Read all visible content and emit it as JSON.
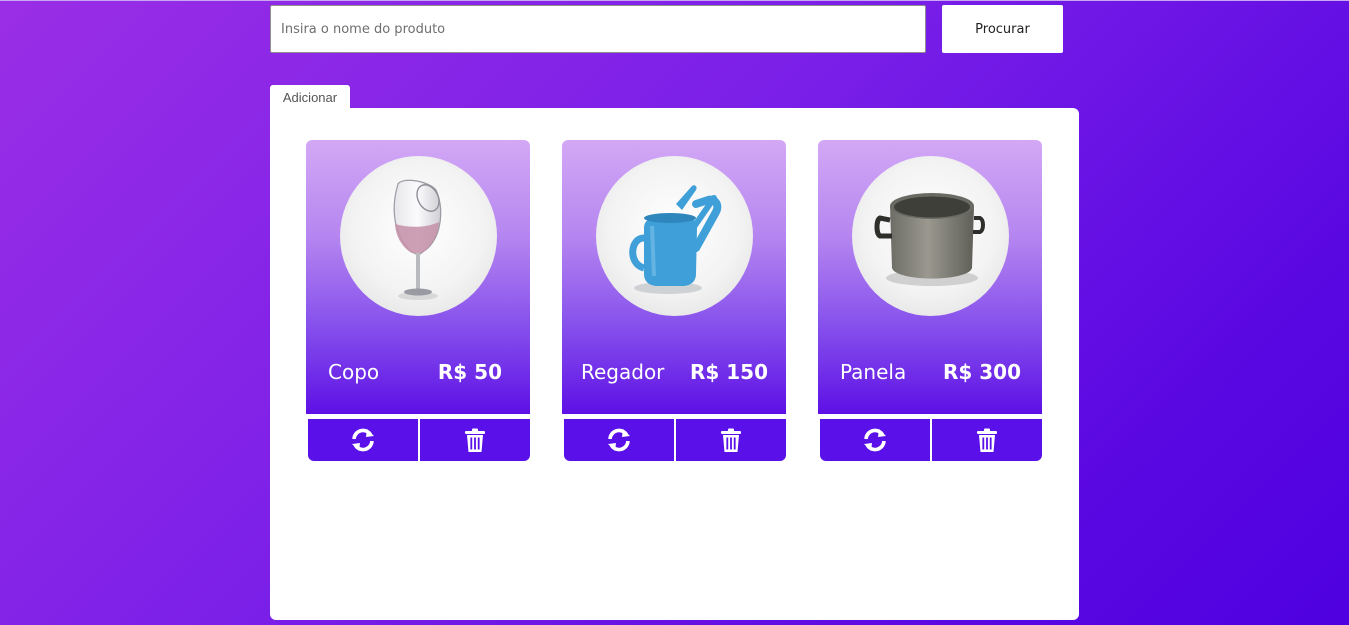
{
  "search": {
    "placeholder": "Insira o nome do produto",
    "value": "",
    "button_label": "Procurar"
  },
  "add_tab": {
    "label": "Adicionar"
  },
  "products": [
    {
      "name": "Copo",
      "price": "R$ 50",
      "image_icon": "wine-glass-icon"
    },
    {
      "name": "Regador",
      "price": "R$ 150",
      "image_icon": "watering-can-icon"
    },
    {
      "name": "Panela",
      "price": "R$ 300",
      "image_icon": "cooking-pot-icon"
    }
  ],
  "card_actions": {
    "refresh_icon": "refresh-icon",
    "delete_icon": "trash-icon"
  },
  "colors": {
    "background_start": "#9a2ee6",
    "background_end": "#4f00e0",
    "card_top": "#d3a8f5",
    "card_bottom": "#5e10e6",
    "action_button": "#5a10e8",
    "panel": "#ffffff"
  }
}
